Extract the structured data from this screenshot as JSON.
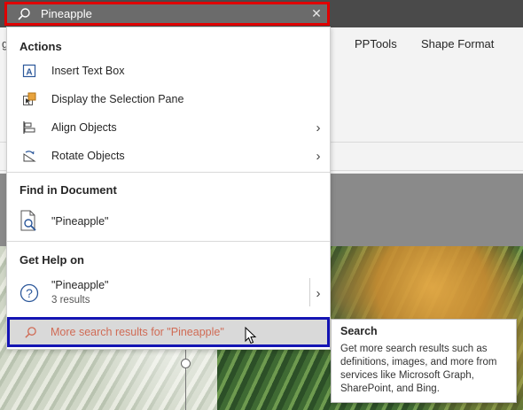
{
  "search": {
    "value": "Pineapple",
    "search_icon": "search-icon",
    "clear_icon": "close-icon"
  },
  "ribbon": {
    "tabs": [
      "PPTools",
      "Shape Format"
    ]
  },
  "actions": {
    "header": "Actions",
    "items": [
      {
        "label": "Insert Text Box",
        "icon": "text-box-icon"
      },
      {
        "label": "Display the Selection Pane",
        "icon": "selection-pane-icon"
      },
      {
        "label": "Align Objects",
        "icon": "align-icon",
        "has_submenu": true
      },
      {
        "label": "Rotate Objects",
        "icon": "rotate-icon",
        "has_submenu": true
      }
    ]
  },
  "find": {
    "header": "Find in Document",
    "item": "\"Pineapple\""
  },
  "help": {
    "header": "Get Help on",
    "item": "\"Pineapple\"",
    "count": "3 results"
  },
  "more": {
    "label": "More search results for \"Pineapple\""
  },
  "tooltip": {
    "title": "Search",
    "body": "Get more search results such as definitions, images, and more from services like Microsoft Graph, SharePoint, and Bing."
  },
  "colors": {
    "highlight_red": "#e00000",
    "highlight_blue": "#1414b4",
    "link_text": "#d06b55",
    "searchbar": "#6b6b6b"
  }
}
